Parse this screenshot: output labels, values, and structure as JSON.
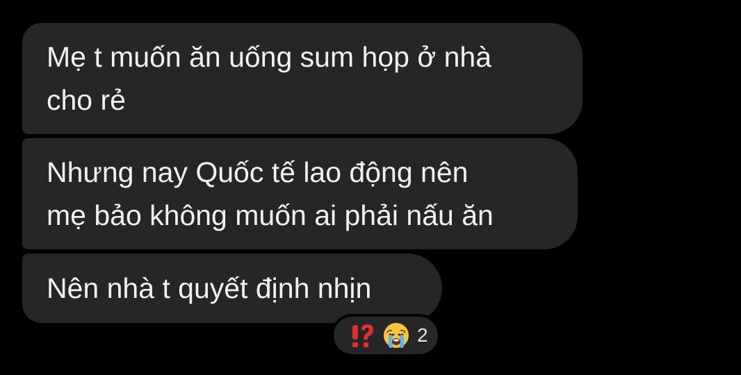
{
  "messages": [
    {
      "lines": [
        "Mẹ t muốn ăn uống sum họp ở nhà",
        "cho rẻ"
      ]
    },
    {
      "lines": [
        "Nhưng nay Quốc tế lao động nên",
        "mẹ bảo không muốn ai phải nấu ăn"
      ]
    },
    {
      "lines": [
        "Nên nhà t quyết định nhịn"
      ]
    }
  ],
  "reactions": {
    "icons": [
      "exclamation-question-icon",
      "crying-face-icon"
    ],
    "count": "2"
  },
  "colors": {
    "background": "#000000",
    "bubble": "#262628",
    "text": "#f2f2f2",
    "accent_red": "#e0302b",
    "emoji_yellow": "#f7c440"
  }
}
